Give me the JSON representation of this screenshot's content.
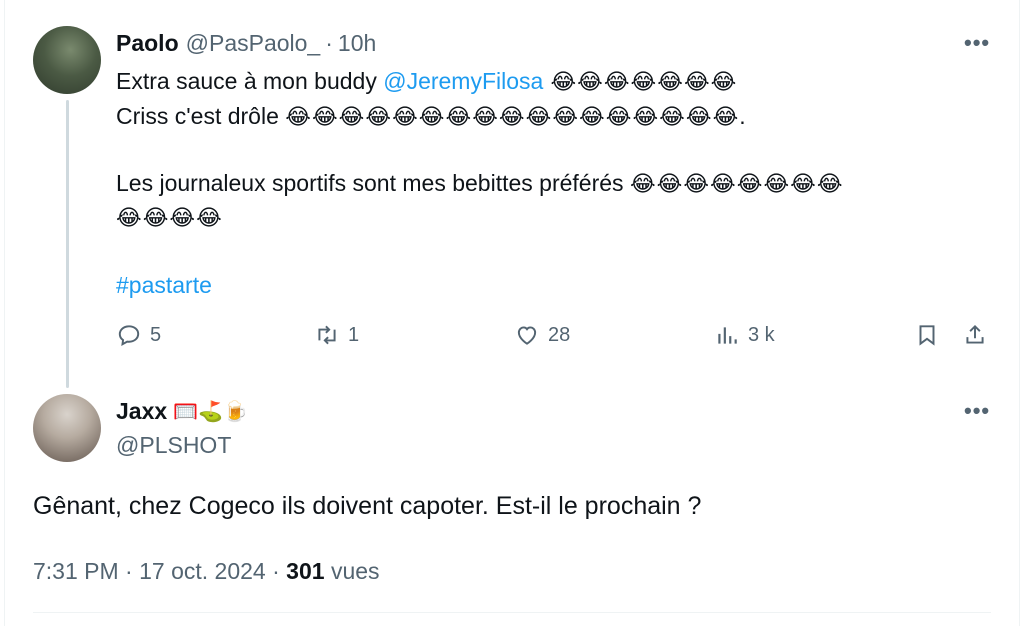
{
  "tweet1": {
    "name": "Paolo",
    "handle": "@PasPaolo_",
    "separator": "·",
    "time": "10h",
    "more": "•••",
    "line1_text": "Extra sauce à mon buddy ",
    "line1_mention": "@JeremyFilosa",
    "line1_emoji": " 😂😂😂😂😂😂😂",
    "line2_text": "Criss c'est drôle ",
    "line2_emoji": "😂😂😂😂😂😂😂😂😂😂😂😂😂😂😂😂😂",
    "line2_end": ".",
    "line3_text": "Les journaleux sportifs sont mes bebittes préférés ",
    "line3_emoji": "😂😂😂😂😂😂😂😂",
    "line4_emoji": "😂😂😂😂",
    "hashtag": "#pastarte",
    "actions": {
      "replies": "5",
      "retweets": "1",
      "likes": "28",
      "views": "3 k"
    }
  },
  "tweet2": {
    "name": "Jaxx",
    "badges": "🥅⛳🍺",
    "handle": "@PLSHOT",
    "more": "•••",
    "text": "Gênant, chez Cogeco ils doivent capoter. Est-il le prochain ?",
    "time": "7:31 PM",
    "separator": "·",
    "date": "17 oct. 2024",
    "separator2": "·",
    "views_count": "301",
    "views_label": "vues"
  },
  "icons": [
    "reply-icon",
    "retweet-icon",
    "like-icon",
    "views-icon",
    "bookmark-icon",
    "share-icon",
    "more-icon"
  ],
  "colors": {
    "link": "#1d9bf0",
    "secondary": "#536471",
    "text": "#0f1419"
  }
}
